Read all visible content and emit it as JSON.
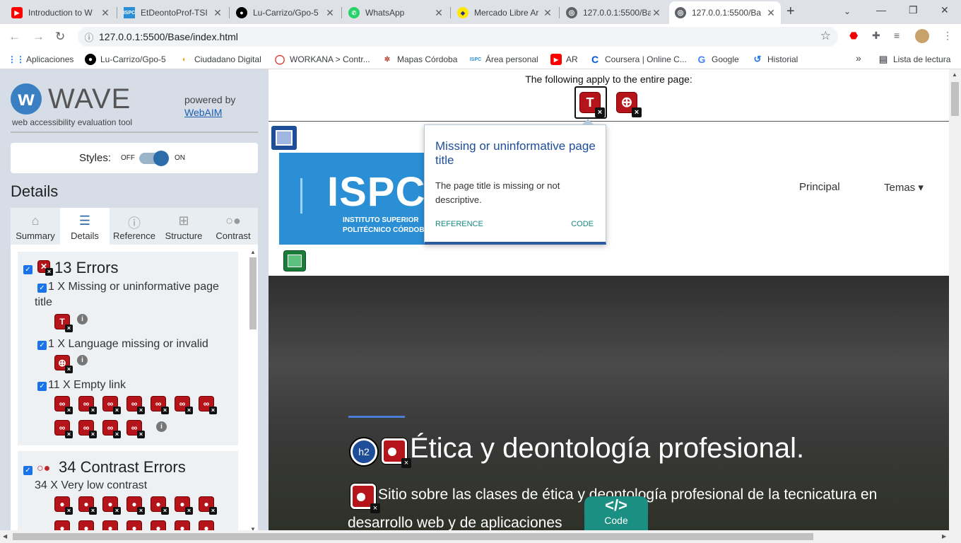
{
  "browser": {
    "tabs": [
      {
        "title": "Introduction to W",
        "icon": "youtube-icon",
        "color": "#ff0000"
      },
      {
        "title": "EtDeontoProf-TSI",
        "icon": "ispc-icon",
        "color": "#2b8fd6"
      },
      {
        "title": "Lu-Carrizo/Gpo-5",
        "icon": "github-icon",
        "color": "#000000"
      },
      {
        "title": "WhatsApp",
        "icon": "whatsapp-icon",
        "color": "#25d366"
      },
      {
        "title": "Mercado Libre Ar",
        "icon": "mercadolibre-icon",
        "color": "#ffe600"
      },
      {
        "title": "127.0.0.1:5500/Ba",
        "icon": "globe-icon",
        "color": "#5f6368"
      },
      {
        "title": "127.0.0.1:5500/Ba",
        "icon": "globe-icon",
        "color": "#5f6368"
      }
    ],
    "url": "127.0.0.1:5500/Base/index.html",
    "bookmarks": [
      {
        "label": "Aplicaciones",
        "icon": "apps-grid-icon"
      },
      {
        "label": "Lu-Carrizo/Gpo-5",
        "icon": "github-icon"
      },
      {
        "label": "Ciudadano Digital",
        "icon": "ciudadano-icon"
      },
      {
        "label": "WORKANA > Contr...",
        "icon": "workana-icon"
      },
      {
        "label": "Mapas Córdoba",
        "icon": "mapas-icon"
      },
      {
        "label": "Área personal",
        "icon": "ispc-icon"
      },
      {
        "label": "AR",
        "icon": "youtube-icon"
      },
      {
        "label": "Coursera | Online C...",
        "icon": "coursera-icon"
      },
      {
        "label": "Google",
        "icon": "google-icon"
      },
      {
        "label": "Historial",
        "icon": "history-icon"
      }
    ],
    "overflow": "»",
    "reading_list": "Lista de lectura"
  },
  "wave": {
    "logo": "WAVE",
    "subtitle": "web accessibility evaluation tool",
    "powered_by": "powered by",
    "webaim": "WebAIM",
    "styles_label": "Styles:",
    "styles_off": "OFF",
    "styles_on": "ON",
    "details_heading": "Details",
    "tabs": [
      "Summary",
      "Details",
      "Reference",
      "Structure",
      "Contrast"
    ],
    "errors": {
      "heading": "13 Errors",
      "items": [
        "1 X Missing or uninformative page",
        "title",
        "1 X Language missing or invalid",
        "11 X Empty link"
      ]
    },
    "contrast": {
      "heading": "34 Contrast Errors",
      "item": "34 X Very low contrast"
    }
  },
  "page": {
    "applies": "The following apply to the entire page:",
    "logo_big": "ISPC",
    "logo_sub1": "INSTITUTO SUPERIOR",
    "logo_sub2": "POLITÉCNICO CÓRDOBA",
    "nav": [
      "Principal",
      "Temas ▾"
    ],
    "h2_badge": "h2",
    "title": "Ética y deontología profesional.",
    "subtitle": "Sitio sobre las clases de ética y deontología profesional de la tecnicatura en",
    "subtitle2": "desarrollo web y de aplicaciones",
    "code_glyph": "</>",
    "code_label": "Code"
  },
  "tooltip": {
    "title": "Missing or uninformative page title",
    "body": "The page title is missing or not descriptive.",
    "reference": "REFERENCE",
    "code": "CODE"
  },
  "colors": {
    "error_red": "#b5141a",
    "structure_blue": "#1f4e99",
    "code_teal": "#1b8f82",
    "wave_bg": "#d6dde6"
  }
}
